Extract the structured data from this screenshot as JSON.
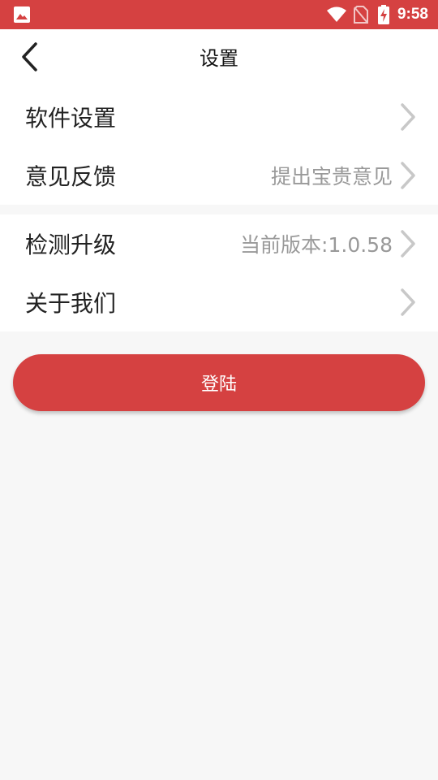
{
  "status_bar": {
    "time": "9:58",
    "icons": [
      "gallery-icon",
      "wifi-icon",
      "no-sim-icon",
      "battery-charging-icon"
    ]
  },
  "header": {
    "title": "设置",
    "back_icon": "back-arrow-icon"
  },
  "settings": {
    "group1": [
      {
        "label": "软件设置",
        "value": ""
      },
      {
        "label": "意见反馈",
        "value": "提出宝贵意见"
      }
    ],
    "group2": [
      {
        "label": "检测升级",
        "value": "当前版本:1.0.58"
      },
      {
        "label": "关于我们",
        "value": ""
      }
    ]
  },
  "login_button": {
    "label": "登陆"
  },
  "colors": {
    "accent": "#d54141",
    "background": "#f7f7f7",
    "secondary_text": "#999999"
  }
}
